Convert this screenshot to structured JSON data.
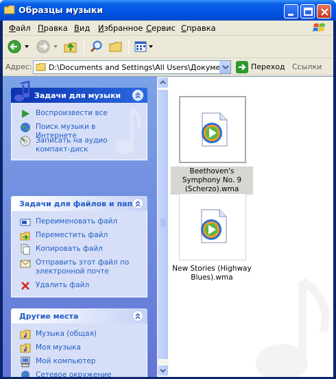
{
  "window": {
    "title": "Образцы музыки"
  },
  "menu": {
    "items": [
      "Файл",
      "Правка",
      "Вид",
      "Избранное",
      "Сервис",
      "Справка"
    ]
  },
  "toolbar": {
    "buttons": [
      "back-icon",
      "forward-icon",
      "up-folder-icon",
      "search-icon",
      "folders-icon",
      "views-icon"
    ]
  },
  "address": {
    "label": "Адрес:",
    "value": "D:\\Documents and Settings\\All Users\\Документы\\Моя",
    "go_label": "Переход",
    "links_label": "Ссылки"
  },
  "taskpane": {
    "music_tasks": {
      "title": "Задачи для музыки",
      "items": [
        {
          "label": "Воспроизвести все",
          "icon": "play-icon"
        },
        {
          "label": "Поиск музыки в Интернете",
          "icon": "globe-icon"
        },
        {
          "label": "Записать на аудио компакт-диск",
          "icon": "cd-burn-icon"
        }
      ]
    },
    "file_tasks": {
      "title": "Задачи для файлов и папок",
      "items": [
        {
          "label": "Переименовать файл",
          "icon": "rename-icon"
        },
        {
          "label": "Переместить файл",
          "icon": "move-icon"
        },
        {
          "label": "Копировать файл",
          "icon": "copy-icon"
        },
        {
          "label": "Отправить этот файл по электронной почте",
          "icon": "email-icon"
        },
        {
          "label": "Удалить файл",
          "icon": "delete-icon"
        }
      ]
    },
    "other_places": {
      "title": "Другие места",
      "items": [
        {
          "label": "Музыка (общая)",
          "icon": "shared-music-folder-icon"
        },
        {
          "label": "Моя музыка",
          "icon": "my-music-folder-icon"
        },
        {
          "label": "Мой компьютер",
          "icon": "my-computer-icon"
        },
        {
          "label": "Сетевое окружение",
          "icon": "network-icon"
        }
      ]
    }
  },
  "files": [
    {
      "name": "Beethoven's Symphony No. 9 (Scherzo).wma",
      "selected": true
    },
    {
      "name": "New Stories (Highway Blues).wma",
      "selected": false
    }
  ],
  "colors": {
    "title_bar": "#0054e3",
    "task_pane": "#6f8ed9",
    "link_text": "#215dc6",
    "selection": "#d8d6d0"
  }
}
